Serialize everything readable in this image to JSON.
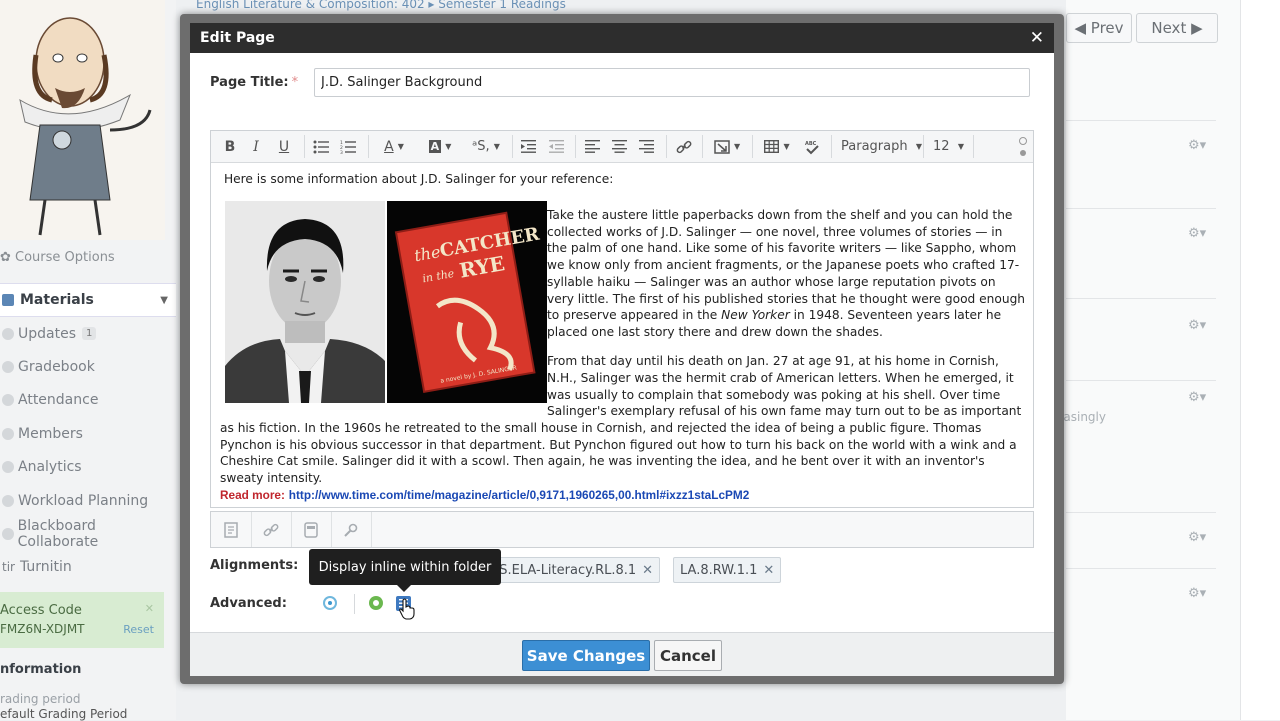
{
  "background": {
    "breadcrumb": "English Literature & Composition: 402  ▸  Semester 1 Readings",
    "header_ghost": "",
    "prev_label": "◀  Prev",
    "next_label": "Next  ▶",
    "course_options": "✿  Course Options",
    "nav_header": "Materials",
    "nav_items": [
      "Updates",
      "Gradebook",
      "Attendance",
      "Members",
      "Analytics",
      "Workload Planning",
      "Blackboard Collaborate",
      "Turnitin"
    ],
    "updates_badge": "1",
    "turnitin_prefix": "tir",
    "access_title": "Access Code",
    "access_code": "FMZ6N-XDJMT",
    "access_reset": "Reset",
    "information": "nformation",
    "grading_label": "rading period",
    "grading_value": "efault Grading Period",
    "faded_text": "easingly"
  },
  "modal": {
    "title": "Edit Page",
    "page_title_label": "Page Title:",
    "page_title_value": "J.D. Salinger Background",
    "toolbar": {
      "paragraph": "Paragraph",
      "font_size": "12"
    },
    "content": {
      "intro": "Here is some information about J.D. Salinger for your reference:",
      "book_label": "a novel by J. D. SALINGER",
      "para1_a": "Take the austere little paperbacks down from the shelf and you can hold the collected works of J.D. Salinger — one novel, three volumes of stories — in the palm of one hand. Like some of his favorite writers — like Sappho, whom we know only from ancient fragments, or the Japanese poets who crafted 17-syllable haiku — Salinger was an author whose large reputation pivots on very little. The first of his published stories that he thought were good enough to preserve appeared in the ",
      "para1_italic": "New Yorker",
      "para1_b": " in 1948. Seventeen years later he placed one last story there and drew down the shades.",
      "para2": "From that day until his death on Jan. 27 at age 91, at his home in Cornish, N.H., Salinger was the hermit crab of American letters. When he emerged, it was usually to complain that somebody was poking at his shell. Over time Salinger's exemplary refusal of his own fame may turn out to be as important as his fiction. In the 1960s he retreated to the small house in Cornish, and rejected the idea of being a public figure. Thomas Pynchon is his obvious successor in that department. But Pynchon figured out how to turn his back on the world with a wink and a Cheshire Cat smile. Salinger did it with a scowl. Then again, he was inventing the idea, and he bent over it with an inventor's sweaty intensity.",
      "read_more": "Read more:",
      "read_more_url": "http://www.time.com/time/magazine/article/0,9171,1960265,00.html#ixzz1staLcPM2"
    },
    "alignments_label": "Alignments:",
    "alignment_chips": [
      "SS.ELA-Literacy.RL.8.1",
      "LA.8.RW.1.1"
    ],
    "tooltip": "Display inline within folder",
    "advanced_label": "Advanced:",
    "save_label": "Save Changes",
    "cancel_label": "Cancel"
  }
}
